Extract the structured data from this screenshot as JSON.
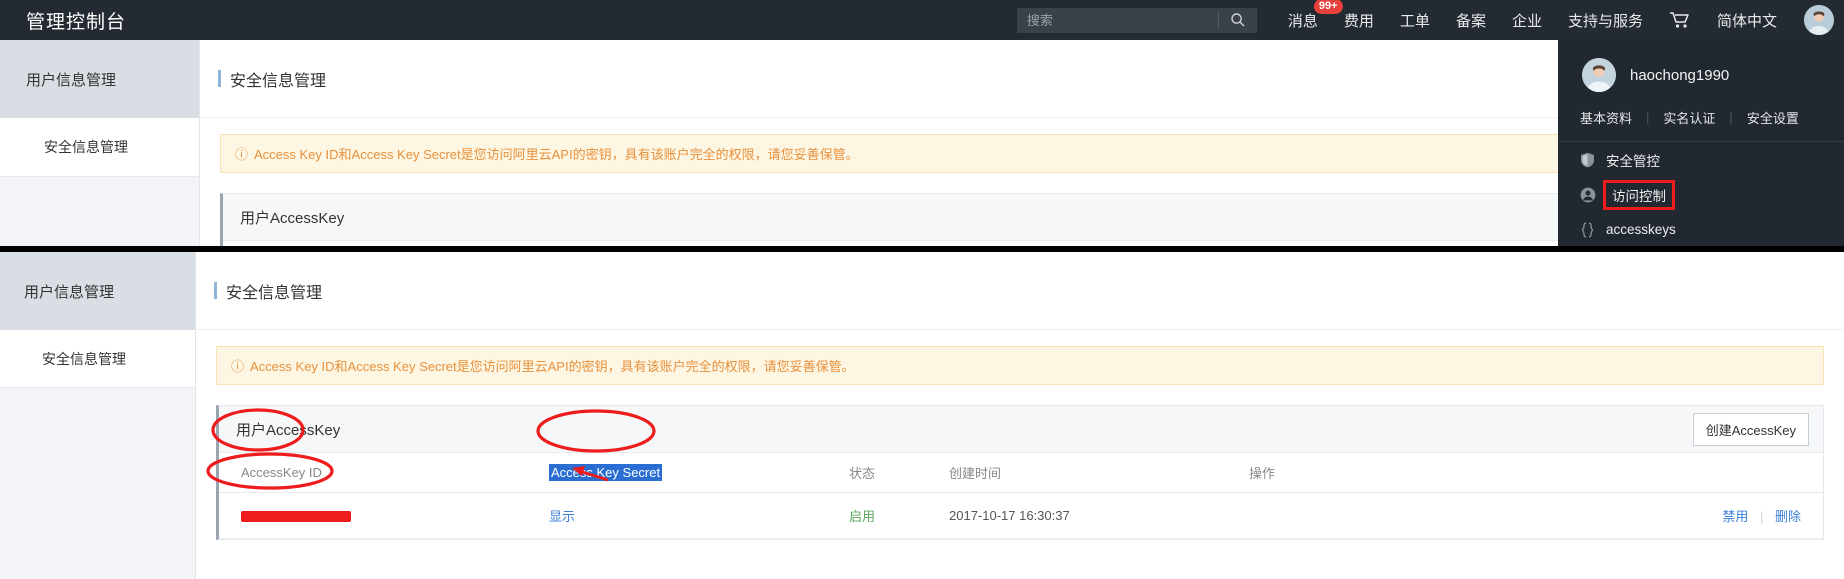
{
  "window": {
    "brand": "管理控制台"
  },
  "search": {
    "placeholder": "搜索",
    "icon": "search-icon",
    "value": ""
  },
  "topnav": {
    "items": [
      {
        "label": "消息",
        "badge": "99+"
      },
      {
        "label": "费用",
        "badge": ""
      },
      {
        "label": "工单",
        "badge": ""
      },
      {
        "label": "备案",
        "badge": ""
      },
      {
        "label": "企业",
        "badge": ""
      },
      {
        "label": "支持与服务",
        "badge": ""
      }
    ],
    "cart_icon": "cart-icon",
    "language": "简体中文",
    "avatar_icon": "user-avatar-icon"
  },
  "sidebar": {
    "header": "用户信息管理",
    "items": [
      {
        "label": "安全信息管理"
      }
    ]
  },
  "main": {
    "page_title": "安全信息管理",
    "notice": {
      "icon": "exclamation-circle-icon",
      "text": "Access Key ID和Access Key Secret是您访问阿里云API的密钥，具有该账户完全的权限，请您妥善保管。"
    },
    "card": {
      "title": "用户AccessKey",
      "create_button": "创建AccessKey"
    },
    "table": {
      "headers": [
        "AccessKey ID",
        "Access Key Secret",
        "状态",
        "创建时间",
        "操作"
      ],
      "rows": [
        {
          "access_key_id": "",
          "access_key_id_redacted": true,
          "secret_link": "显示",
          "status": "启用",
          "created_at": "2017-10-17 16:30:37",
          "actions": [
            "禁用",
            "删除"
          ],
          "action_separator": "|"
        }
      ]
    }
  },
  "user_panel": {
    "username": "haochong1990",
    "avatar_icon": "user-avatar-icon",
    "links": [
      "基本资料",
      "实名认证",
      "安全设置"
    ],
    "link_separator": "|",
    "menu": [
      {
        "label": "安全管控",
        "icon": "shield-icon",
        "highlighted": false
      },
      {
        "label": "访问控制",
        "icon": "person-circle-icon",
        "highlighted": true
      },
      {
        "label": "accesskeys",
        "icon": "curly-braces-icon",
        "highlighted": false
      }
    ]
  },
  "annotations": {
    "accent_red": "#ee1c1c",
    "selection_blue": "#2a6ed4",
    "ellipses": [
      "AccessKey ID 表头",
      "Access Key Secret 表头",
      "AccessKey ID 值(已涂抹)"
    ],
    "arrow": "指向 显示 链接"
  },
  "colors": {
    "topbar_bg": "#242a32",
    "panel_bg": "#22282f",
    "notice_bg": "#fdf6e3",
    "notice_text": "#e8913c",
    "link": "#3b7fd4",
    "enabled_green": "#5aa75a"
  }
}
